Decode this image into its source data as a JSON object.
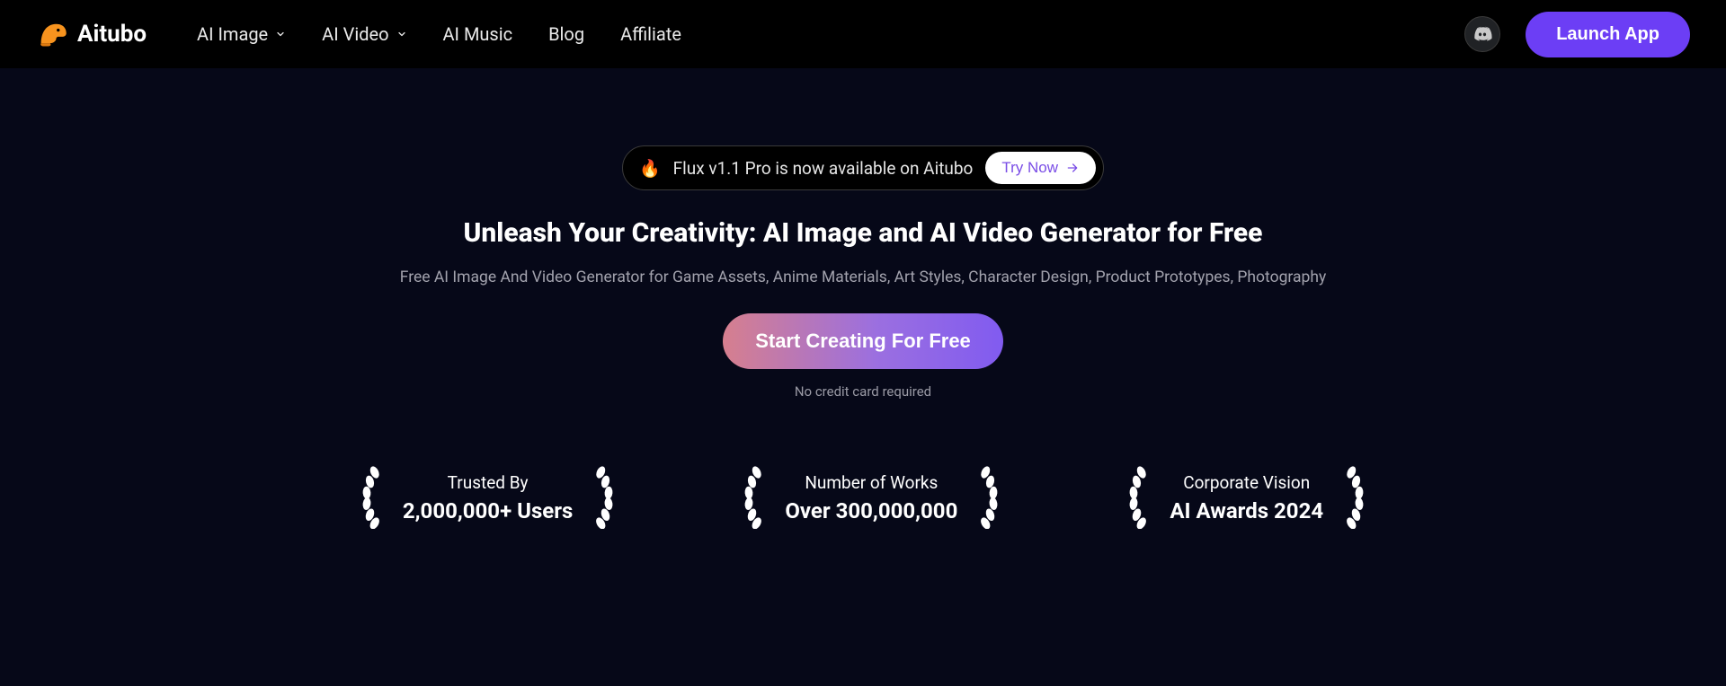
{
  "brand": {
    "name": "Aitubo"
  },
  "nav": {
    "items": [
      {
        "label": "AI Image",
        "hasDropdown": true
      },
      {
        "label": "AI Video",
        "hasDropdown": true
      },
      {
        "label": "AI Music",
        "hasDropdown": false
      },
      {
        "label": "Blog",
        "hasDropdown": false
      },
      {
        "label": "Affiliate",
        "hasDropdown": false
      }
    ]
  },
  "header": {
    "launch": "Launch App"
  },
  "promo": {
    "text": "Flux v1.1 Pro is now available on Aitubo",
    "cta": "Try Now"
  },
  "hero": {
    "title": "Unleash Your Creativity: AI Image and AI Video Generator for Free",
    "subtitle": "Free AI Image And Video Generator for Game Assets, Anime Materials, Art Styles, Character Design, Product Prototypes, Photography",
    "cta": "Start Creating For Free",
    "note": "No credit card required"
  },
  "stats": [
    {
      "top": "Trusted By",
      "bottom": "2,000,000+ Users"
    },
    {
      "top": "Number of Works",
      "bottom": "Over 300,000,000"
    },
    {
      "top": "Corporate Vision",
      "bottom": "AI Awards 2024"
    }
  ],
  "colors": {
    "accent": "#6C3EF5",
    "background": "#060818"
  }
}
